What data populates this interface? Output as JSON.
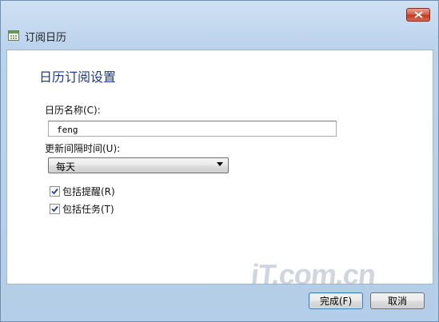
{
  "window": {
    "title": "订阅日历",
    "close_icon": "close-icon",
    "app_icon": "calendar-icon"
  },
  "dialog": {
    "heading": "日历订阅设置",
    "name_label": "日历名称(C):",
    "name_value": "feng",
    "interval_label": "更新间隔时间(U):",
    "interval_value": "每天",
    "include_reminders_label": "包括提醒(R)",
    "include_reminders_checked": true,
    "include_tasks_label": "包括任务(T)",
    "include_tasks_checked": true
  },
  "watermark": "iT.com.cn",
  "buttons": {
    "finish_label": "完成(F)",
    "cancel_label": "取消"
  }
}
